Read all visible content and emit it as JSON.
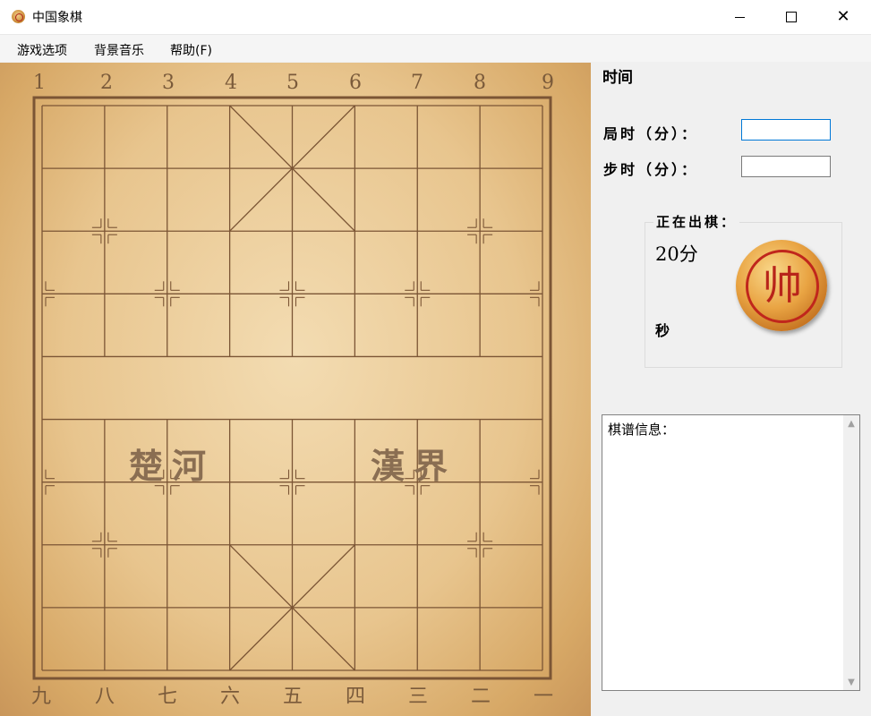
{
  "window": {
    "title": "中国象棋",
    "icon": "xiangqi-app-icon",
    "controls": {
      "minimize": "minimize-icon",
      "maximize": "maximize-icon",
      "close": "close-icon"
    }
  },
  "menu": {
    "items": [
      {
        "label": "游戏选项"
      },
      {
        "label": "背景音乐"
      },
      {
        "label": "帮助(F)"
      }
    ]
  },
  "board": {
    "top_numbers": [
      "1",
      "2",
      "3",
      "4",
      "5",
      "6",
      "7",
      "8",
      "9"
    ],
    "bottom_numbers": [
      "九",
      "八",
      "七",
      "六",
      "五",
      "四",
      "三",
      "二",
      "一"
    ],
    "river_left": "楚河",
    "river_right": "漢界"
  },
  "panel": {
    "time_heading": "时间",
    "game_time_label": "局时（分）：",
    "game_time_value": "",
    "step_time_label": "步时（分）：",
    "step_time_value": "",
    "turn_group_title": "正在出棋：",
    "minutes_text": "20分",
    "seconds_text": "秒",
    "current_piece_char": "帅",
    "record_label": "棋谱信息："
  },
  "colors": {
    "board_line": "#7b5535",
    "piece_red": "#b8241a",
    "focus_border": "#0078d7"
  }
}
